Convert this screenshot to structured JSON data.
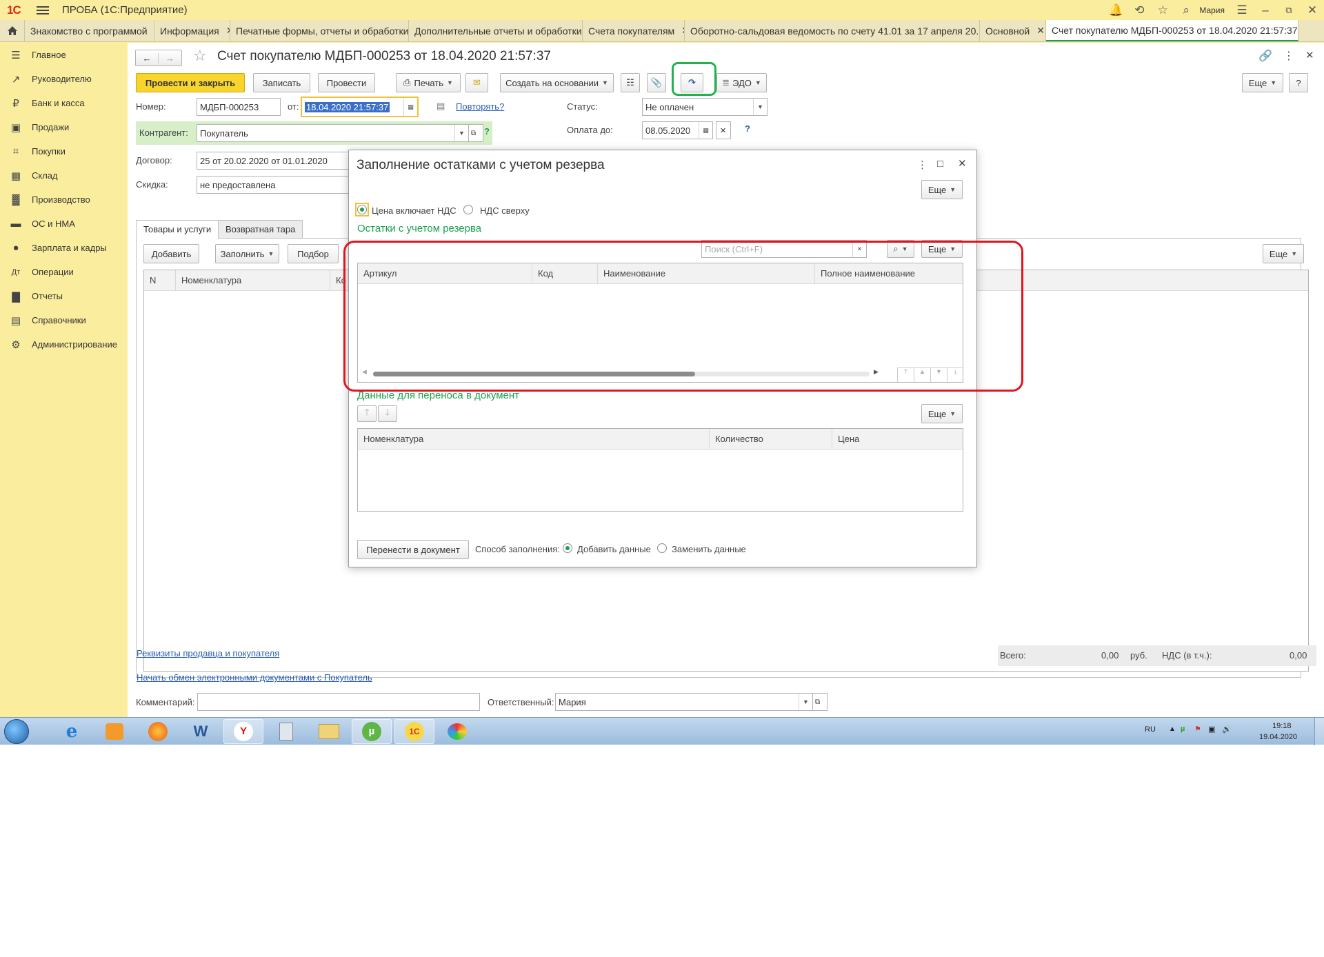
{
  "app": {
    "title": "ПРОБА (1С:Предприятие)",
    "user": "Мария"
  },
  "tabs": [
    "Знакомство с программой",
    "Информация",
    "Печатные формы, отчеты и обработки",
    "Дополнительные отчеты и обработки",
    "Счета покупателям",
    "Оборотно-сальдовая ведомость по счету 41.01 за 17 апреля 20...",
    "Основной",
    "Счет покупателю МДБП-000253 от 18.04.2020 21:57:37"
  ],
  "sidebar": [
    {
      "label": "Главное",
      "icon": "menu-icon"
    },
    {
      "label": "Руководителю",
      "icon": "trend-icon"
    },
    {
      "label": "Банк и касса",
      "icon": "ruble-icon"
    },
    {
      "label": "Продажи",
      "icon": "bag-icon"
    },
    {
      "label": "Покупки",
      "icon": "cart-icon"
    },
    {
      "label": "Склад",
      "icon": "grid-icon"
    },
    {
      "label": "Производство",
      "icon": "factory-icon"
    },
    {
      "label": "ОС и НМА",
      "icon": "truck-icon"
    },
    {
      "label": "Зарплата и кадры",
      "icon": "person-icon"
    },
    {
      "label": "Операции",
      "icon": "operations-icon"
    },
    {
      "label": "Отчеты",
      "icon": "chart-icon"
    },
    {
      "label": "Справочники",
      "icon": "book-icon"
    },
    {
      "label": "Администрирование",
      "icon": "gear-icon"
    }
  ],
  "doc": {
    "title": "Счет покупателю МДБП-000253 от 18.04.2020 21:57:37",
    "toolbar": {
      "post_close": "Провести и закрыть",
      "save": "Записать",
      "post": "Провести",
      "print": "Печать",
      "create_based": "Создать на основании",
      "edo": "ЭДО",
      "more": "Еще",
      "help": "?"
    },
    "number_label": "Номер:",
    "number": "МДБП-000253",
    "date_label": "от:",
    "date": "18.04.2020 21:57:37",
    "repeat": "Повторять?",
    "status_label": "Статус:",
    "status": "Не оплачен",
    "pay_until_label": "Оплата до:",
    "pay_until": "08.05.2020",
    "counterparty_label": "Контрагент:",
    "counterparty": "Покупатель",
    "contract_label": "Договор:",
    "contract": "25 от 20.02.2020 от 01.01.2020",
    "discount_label": "Скидка:",
    "discount": "не предоставлена",
    "tab_goods": "Товары и услуги",
    "tab_tare": "Возвратная тара",
    "add": "Добавить",
    "fill": "Заполнить",
    "pick": "Подбор",
    "more": "Еще",
    "col_n": "N",
    "col_nom": "Номенклатура",
    "col_ko": "Ко",
    "link_requisites": "Реквизиты продавца и покупателя",
    "link_exchange": "Начать обмен электронными документами с Покупатель",
    "total_label": "Всего:",
    "total": "0,00",
    "currency": "руб.",
    "vat_label": "НДС (в т.ч.):",
    "vat": "0,00",
    "comment_label": "Комментарий:",
    "responsible_label": "Ответственный:",
    "responsible": "Мария"
  },
  "modal": {
    "title": "Заполнение остатками с учетом резерва",
    "more": "Еще",
    "radio_incl": "Цена включает НДС",
    "radio_top": "НДС сверху",
    "section1": "Остатки с учетом резерва",
    "search_placeholder": "Поиск (Ctrl+F)",
    "cols1": [
      "Артикул",
      "Код",
      "Наименование",
      "Полное наименование"
    ],
    "section2": "Данные для переноса в документ",
    "cols2": [
      "Номенклатура",
      "Количество",
      "Цена"
    ],
    "transfer": "Перенести в документ",
    "fill_mode_label": "Способ заполнения:",
    "fill_add": "Добавить данные",
    "fill_replace": "Заменить данные"
  },
  "taskbar": {
    "lang": "RU",
    "time": "19:18",
    "date": "19.04.2020"
  },
  "colors": {
    "accent_green": "#1aa14e",
    "highlight_red": "#e3141c",
    "primary_yellow": "#f8d52d",
    "panel_yellow": "#fbed9e"
  }
}
